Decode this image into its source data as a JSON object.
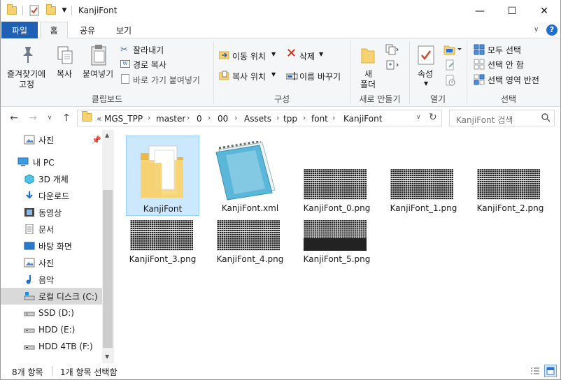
{
  "window": {
    "title": "KanjiFont",
    "minimize": "—",
    "maximize": "☐",
    "close": "✕"
  },
  "ribbon_tabs": [
    {
      "label": "파일"
    },
    {
      "label": "홈"
    },
    {
      "label": "공유"
    },
    {
      "label": "보기"
    }
  ],
  "ribbon": {
    "pin_label_1": "즐겨찾기에",
    "pin_label_2": "고정",
    "copy": "복사",
    "paste": "붙여넣기",
    "cut": "잘라내기",
    "copy_path": "경로 복사",
    "paste_shortcut": "바로 가기 붙여넣기",
    "move_to": "이동 위치",
    "copy_to": "복사 위치",
    "delete": "삭제",
    "rename": "이름 바꾸기",
    "new_folder_1": "새",
    "new_folder_2": "폴더",
    "properties": "속성",
    "select_all": "모두 선택",
    "select_none": "선택 안 함",
    "invert_selection": "선택 영역 반전",
    "group_clipboard": "클립보드",
    "group_organize": "구성",
    "group_new": "새로 만들기",
    "group_open": "열기",
    "group_select": "선택"
  },
  "address": {
    "prefix": "«",
    "crumbs": [
      "MGS_TPP",
      "master",
      "0",
      "00",
      "Assets",
      "tpp",
      "font",
      "KanjiFont"
    ],
    "search_placeholder": "KanjiFont 검색"
  },
  "nav": [
    {
      "label": "사진",
      "icon": "pictures-icon"
    },
    {
      "label": "내 PC",
      "icon": "pc-icon"
    },
    {
      "label": "3D 개체",
      "icon": "3d-objects-icon"
    },
    {
      "label": "다운로드",
      "icon": "download-icon"
    },
    {
      "label": "동영상",
      "icon": "video-icon"
    },
    {
      "label": "문서",
      "icon": "document-icon"
    },
    {
      "label": "바탕 화면",
      "icon": "desktop-icon"
    },
    {
      "label": "사진",
      "icon": "pictures-icon"
    },
    {
      "label": "음악",
      "icon": "music-icon"
    },
    {
      "label": "로컬 디스크 (C:)",
      "icon": "local-disk-icon"
    },
    {
      "label": "SSD (D:)",
      "icon": "drive-icon"
    },
    {
      "label": "HDD (E:)",
      "icon": "drive-icon"
    },
    {
      "label": "HDD 4TB (F:)",
      "icon": "drive-icon"
    }
  ],
  "files": [
    {
      "name": "KanjiFont",
      "type": "folder"
    },
    {
      "name": "KanjiFont.xml",
      "type": "xml"
    },
    {
      "name": "KanjiFont_0.png",
      "type": "png"
    },
    {
      "name": "KanjiFont_1.png",
      "type": "png"
    },
    {
      "name": "KanjiFont_2.png",
      "type": "png"
    },
    {
      "name": "KanjiFont_3.png",
      "type": "png"
    },
    {
      "name": "KanjiFont_4.png",
      "type": "png"
    },
    {
      "name": "KanjiFont_5.png",
      "type": "png"
    }
  ],
  "status": {
    "count": "8개 항목",
    "selected": "1개 항목 선택함"
  },
  "colors": {
    "file_tab": "#1f5fb4",
    "selection": "#cce8ff",
    "folder": "#f6d272"
  }
}
